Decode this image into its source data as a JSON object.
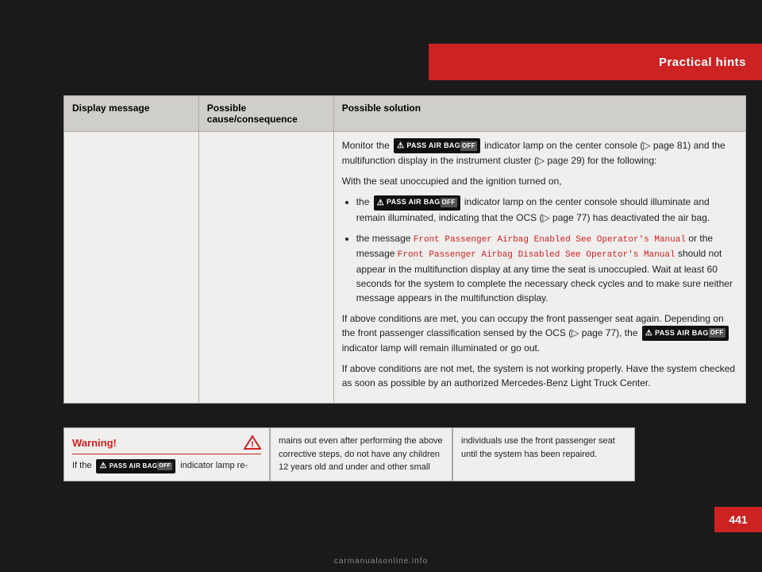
{
  "header": {
    "title": "Practical hints"
  },
  "table": {
    "columns": [
      "Display message",
      "Possible cause/consequence",
      "Possible solution"
    ],
    "rows": [
      {
        "display_message": "",
        "possible_cause": "",
        "possible_solution_paragraphs": [
          "Monitor the [BADGE] indicator lamp on the center console (▷ page 81) and the multifunction display in the instrument cluster (▷ page 29) for the following:",
          "With the seat unoccupied and the ignition turned on,",
          "BULLET1",
          "BULLET2",
          "If above conditions are met, you can occupy the front passenger seat again. Depending on the front passenger classification sensed by the OCS (▷ page 77), the [BADGE] indicator lamp will remain illuminated or go out.",
          "If above conditions are not met, the system is not working properly. Have the system checked as soon as possible by an authorized Mercedes-Benz Light Truck Center."
        ]
      }
    ]
  },
  "warning": {
    "label": "Warning!",
    "body_start": "If the",
    "body_end": "indicator lamp re-"
  },
  "warning_text1": "mains out even after performing the above corrective steps, do not have any children 12 years old and under and other small",
  "warning_text2": "individuals use the front passenger seat until the system has been repaired.",
  "page_number": "441",
  "watermark": "carmanualsonline.info",
  "bullet1": "the [BADGE] indicator lamp on the center console should illuminate and remain illuminated, indicating that the OCS (▷ page 77) has deactivated the air bag.",
  "bullet2_start": "the message ",
  "bullet2_code1": "Front Passenger Airbag Enabled See Operator's Manual",
  "bullet2_mid": " or the message ",
  "bullet2_code2": "Front Passenger Airbag Disabled See Operator's Manual",
  "bullet2_end": " should not appear in the multifunction display at any time the seat is unoccupied. Wait at least 60 seconds for the system to complete the necessary check cycles and to make sure neither message appears in the multifunction display."
}
